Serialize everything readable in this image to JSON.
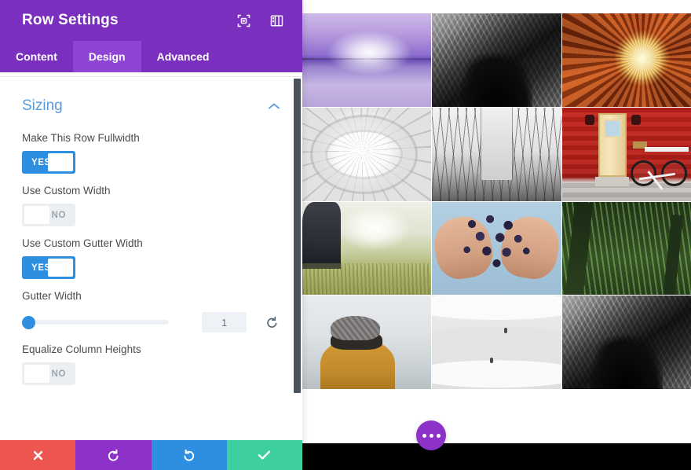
{
  "panel": {
    "title": "Row Settings",
    "header_icons": [
      {
        "name": "focus-target-icon",
        "label": "Focus"
      },
      {
        "name": "layout-columns-icon",
        "label": "Layout"
      }
    ],
    "tabs": [
      {
        "label": "Content",
        "active": false
      },
      {
        "label": "Design",
        "active": true
      },
      {
        "label": "Advanced",
        "active": false
      }
    ],
    "section": {
      "title": "Sizing",
      "collapse_icon": "chevron-up-icon",
      "accent_color": "#5a9bd8"
    },
    "fields": [
      {
        "label": "Make This Row Fullwidth",
        "type": "toggle",
        "value": "YES"
      },
      {
        "label": "Use Custom Width",
        "type": "toggle",
        "value": "NO"
      },
      {
        "label": "Use Custom Gutter Width",
        "type": "toggle",
        "value": "YES"
      },
      {
        "label": "Gutter Width",
        "type": "slider",
        "value": "1",
        "slider_percent": 0,
        "reset_icon": "reset-arrow-icon"
      },
      {
        "label": "Equalize Column Heights",
        "type": "toggle",
        "value": "NO"
      }
    ],
    "footer_buttons": [
      {
        "name": "cancel-button",
        "icon": "close-x-icon",
        "color": "#ec5550"
      },
      {
        "name": "undo-button",
        "icon": "undo-arrow-icon",
        "color": "#8d32c9"
      },
      {
        "name": "redo-button",
        "icon": "redo-arrow-icon",
        "color": "#2e8fe0"
      },
      {
        "name": "save-button",
        "icon": "checkmark-icon",
        "color": "#3ecfa0"
      }
    ],
    "colors": {
      "header_purple": "#7b2fbe",
      "tab_active_purple": "#8f45d4",
      "toggle_on_blue": "#2e8fe0",
      "toggle_off_gray": "#eceff1"
    }
  },
  "preview": {
    "more_button": {
      "name": "more-options-button",
      "icon": "ellipsis-icon",
      "color": "#8d32c9"
    },
    "gallery": [
      {
        "alt": "Purple sunset over calm water"
      },
      {
        "alt": "Black and white arched ceiling looking up"
      },
      {
        "alt": "Orange library dome with bright light"
      },
      {
        "alt": "White museum skylight dome"
      },
      {
        "alt": "Brooklyn Bridge cables and city skyline"
      },
      {
        "alt": "Red wall with yellow door and bicycle"
      },
      {
        "alt": "Person standing in sunlit field"
      },
      {
        "alt": "Hands holding a cluster of dark grapes"
      },
      {
        "alt": "Green bamboo forest canopy"
      },
      {
        "alt": "Person in mustard coat and knit hat in fog"
      },
      {
        "alt": "Guggenheim museum spiral ramps"
      },
      {
        "alt": "Black and white arched ceiling looking up"
      }
    ]
  }
}
